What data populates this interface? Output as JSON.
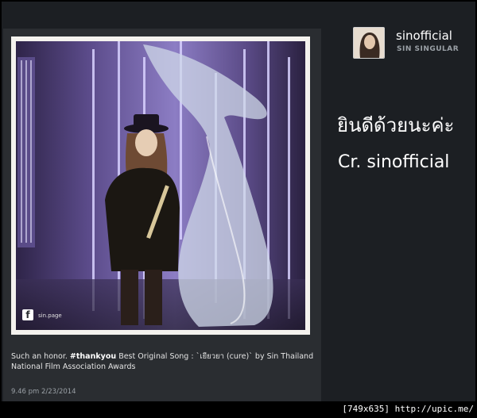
{
  "post": {
    "username": "sinofficial",
    "display_name": "SIN SINGULAR",
    "caption_hashtag": "#thankyou",
    "caption_prefix": "Such an honor. ",
    "caption_suffix": " Best Original Song : `เยียวยา (cure)` by Sin Thailand National Film Association Awards",
    "timestamp": "9.46 pm 2/23/2014",
    "photo_watermark": "sin.page",
    "photo_watermark_icon": "facebook-icon"
  },
  "overlay": {
    "line1": "ยินดีด้วยนะค่ะ",
    "line2": "Cr. sinofficial"
  },
  "footer": {
    "text": "[749x635] http://upic.me/"
  },
  "colors": {
    "background": "#000000",
    "panel": "#2a2d31",
    "side": "#1c1f23",
    "photo_border": "#f4f2ee",
    "muted_text": "#9aa0a6"
  }
}
